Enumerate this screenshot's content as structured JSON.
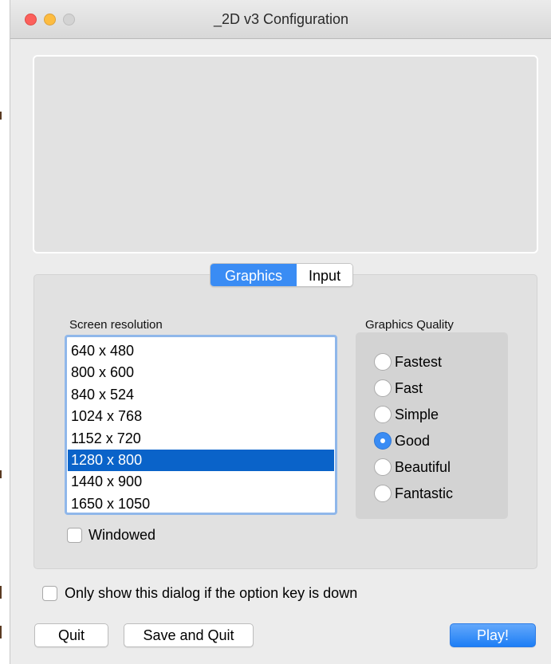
{
  "window": {
    "title": "_2D v3 Configuration"
  },
  "tabs": [
    {
      "label": "Graphics",
      "active": true
    },
    {
      "label": "Input",
      "active": false
    }
  ],
  "graphics": {
    "resolution_label": "Screen resolution",
    "resolutions": [
      "640 x 480",
      "800 x 600",
      "840 x 524",
      "1024 x 768",
      "1152 x 720",
      "1280 x 800",
      "1440 x 900",
      "1650 x 1050"
    ],
    "selected_resolution": "1280 x 800",
    "windowed_label": "Windowed",
    "windowed_checked": false,
    "quality_label": "Graphics Quality",
    "quality_options": [
      "Fastest",
      "Fast",
      "Simple",
      "Good",
      "Beautiful",
      "Fantastic"
    ],
    "selected_quality": "Good"
  },
  "option_key_label": "Only show this dialog if the option key is down",
  "option_key_checked": false,
  "buttons": {
    "quit": "Quit",
    "save_quit": "Save and Quit",
    "play": "Play!"
  },
  "colors": {
    "accent": "#3a8cf4",
    "selection": "#0a63c9"
  }
}
